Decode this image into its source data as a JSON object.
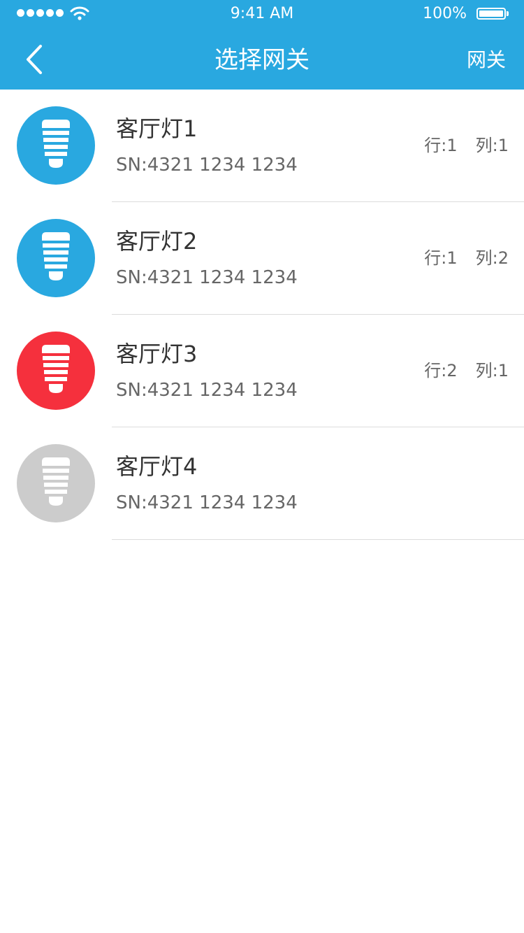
{
  "status_bar": {
    "time": "9:41 AM",
    "battery": "100%"
  },
  "nav": {
    "title": "选择网关",
    "right_label": "网关"
  },
  "colors": {
    "header": "#29a8e0",
    "bulb_blue": "#29a8e0",
    "bulb_red": "#f5303d",
    "bulb_gray": "#cccccc"
  },
  "items": [
    {
      "name": "客厅灯1",
      "sn": "SN:4321 1234 1234",
      "row": "行:1",
      "col": "列:1",
      "status_color": "#29a8e0"
    },
    {
      "name": "客厅灯2",
      "sn": "SN:4321 1234 1234",
      "row": "行:1",
      "col": "列:2",
      "status_color": "#29a8e0"
    },
    {
      "name": "客厅灯3",
      "sn": "SN:4321 1234 1234",
      "row": "行:2",
      "col": "列:1",
      "status_color": "#f5303d"
    },
    {
      "name": "客厅灯4",
      "sn": "SN:4321 1234 1234",
      "row": "",
      "col": "",
      "status_color": "#cccccc"
    }
  ]
}
